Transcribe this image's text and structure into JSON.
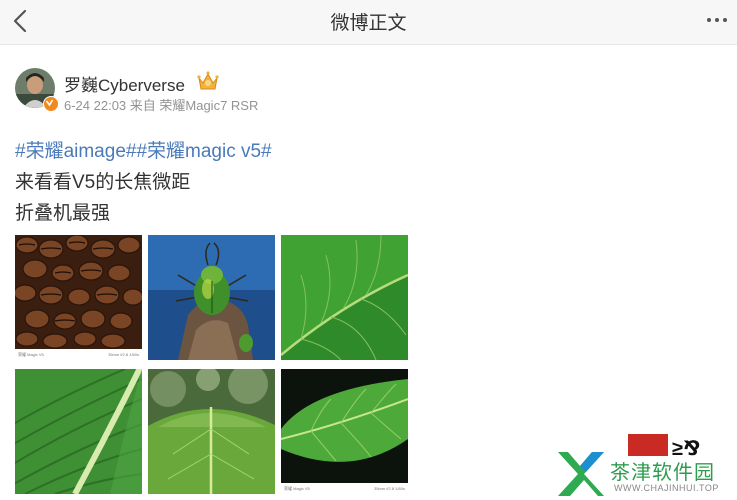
{
  "header": {
    "title": "微博正文",
    "back_icon": "chevron-left-icon",
    "more_icon": "more-horizontal-icon"
  },
  "post": {
    "author": "罗巍Cyberverse",
    "verified_badge": "v-badge-icon",
    "member_badge": "crown-icon",
    "meta": "6-24 22:03 来自 荣耀Magic7 RSR",
    "hashtags": [
      "#荣耀aimage#",
      "#荣耀magic v5#"
    ],
    "lines": [
      "来看看V5的长焦微距",
      "折叠机最强"
    ],
    "images": [
      {
        "subject": "coffee-beans",
        "caption_left": "荣耀 Magic V5",
        "caption_right": "35mm f/2.8 1/60s"
      },
      {
        "subject": "green-beetle"
      },
      {
        "subject": "leaf-macro"
      },
      {
        "subject": "banana-leaf"
      },
      {
        "subject": "leaf-bokeh"
      },
      {
        "subject": "leaf-dark",
        "caption_left": "荣耀 Magic V5",
        "caption_right": "35mm f/2.8 1/60s"
      }
    ]
  },
  "watermark": {
    "name": "茶津软件园",
    "url": "WWW.CHAJINHUI.TOP",
    "partial_text": "≥⅋"
  },
  "colors": {
    "link": "#4a7ab8",
    "badge": "#f08a1c",
    "watermark_green": "#2e9c4f"
  }
}
